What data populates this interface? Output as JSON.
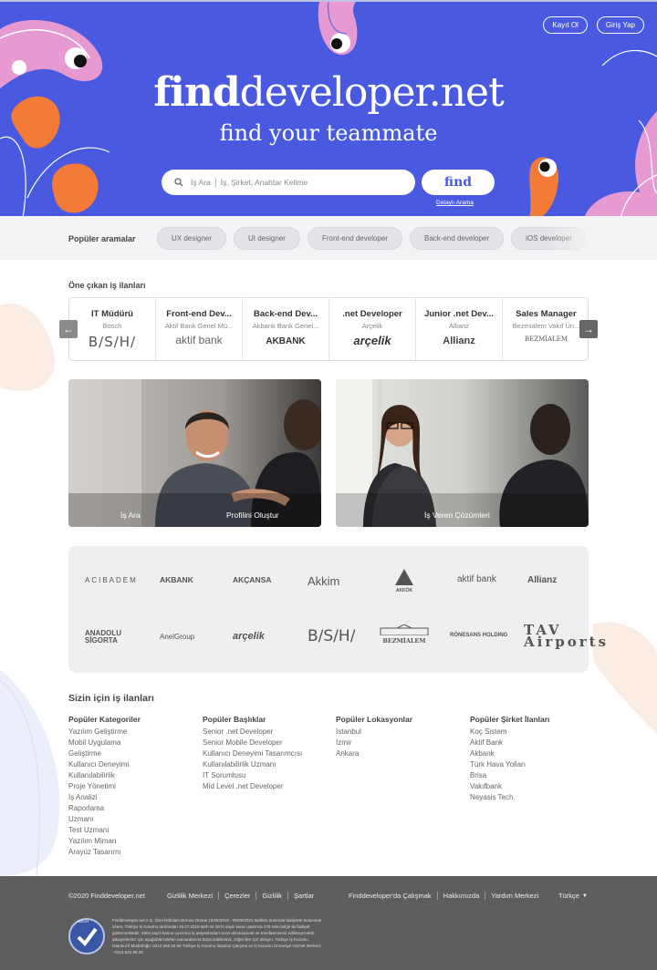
{
  "header": {
    "register": "Kayıt Ol",
    "login": "Giriş Yap",
    "logo_bold": "find",
    "logo_rest": "developer.net",
    "tagline": "find your teammate",
    "search_label": "İş Ara",
    "search_placeholder": "İş, Şirket, Anahtar Kelime",
    "find_button": "find",
    "advanced_search": "Detaylı Arama"
  },
  "popular": {
    "label": "Popüler aramalar",
    "chips": [
      "UX designer",
      "UI designer",
      "Front-end developer",
      "Back-end developer",
      "iOS developer"
    ]
  },
  "featured": {
    "title": "Öne çıkan iş ilanları",
    "jobs": [
      {
        "title": "IT Müdürü",
        "company": "Bosch",
        "logo": "B/S/H/"
      },
      {
        "title": "Front-end Dev...",
        "company": "Aktif Bank Genel Mü...",
        "logo": "aktif bank"
      },
      {
        "title": "Back-end Dev...",
        "company": "Akbank Bank Genel...",
        "logo": "AKBANK"
      },
      {
        "title": ".net Developer",
        "company": "Arçelik",
        "logo": "arçelik"
      },
      {
        "title": "Junior .net Dev...",
        "company": "Allianz",
        "logo": "Allianz"
      },
      {
        "title": "Sales Manager",
        "company": "Bezmialem Vakıf Ün...",
        "logo": "BEZMİALEM"
      }
    ]
  },
  "cards": {
    "job_search": "İş Ara",
    "create_profile": "Profilini Oluştur",
    "employer": "İş Veren Çözümleri"
  },
  "partners": {
    "row1": [
      "ACIBADEM",
      "AKBANK",
      "AKÇANSA",
      "Akkim",
      "AKKÖK",
      "aktif bank",
      "Allianz"
    ],
    "row2": [
      "ANADOLU SİGORTA",
      "AnelGroup",
      "arçelik",
      "B/S/H/",
      "BEZMİALEM",
      "RÖNESANS HOLDING",
      "TAV Airports"
    ]
  },
  "for_you": {
    "title": "Sizin için iş ilanları",
    "columns": [
      {
        "heading": "Popüler Kategoriler",
        "items": [
          "Yazılım Geliştirme",
          "Mobil Uygulama",
          "Geliştirme",
          "Kullanıcı Deneyimi",
          "Kullanılabilirlik",
          "Proje Yönetimi",
          "İş Analizi",
          "Raporlama",
          "Uzmanı",
          "Test Uzmanı",
          "Yazılım Mimarı",
          "Arayüz Tasarımı"
        ]
      },
      {
        "heading": "Popüler Başlıklar",
        "items": [
          "Senior .net Developer",
          "Senior Mobile Developer",
          "Kullanıcı Deneyimi Tasarımcısı",
          "Kullanılabilirlik Uzmanı",
          "IT Sorumlusu",
          "Mid Level .net Developer"
        ]
      },
      {
        "heading": "Popüler Lokasyonlar",
        "items": [
          "İstanbul",
          "İzmir",
          "Ankara"
        ]
      },
      {
        "heading": "Popüler Şirket İlanları",
        "items": [
          "Koç Sistem",
          "Aktif Bank",
          "Akbank",
          "Türk Hava Yolları",
          "Brisa",
          "Vakıfbank",
          "Neyasis Tech."
        ]
      }
    ]
  },
  "footer": {
    "copyright": "©2020 Finddeveloper.net",
    "links": [
      "Gizlilik Merkezi",
      "Çerezler",
      "Gizlilik",
      "Şartlar"
    ],
    "right_links": [
      "Finddeveloper'da Çalışmak",
      "Hakkımızda",
      "Yardım Merkezi"
    ],
    "language": "Türkçe",
    "badge": "İŞKUR",
    "legal": "Finddeveloper.net A.Ş. Özel İstihdam Bürosu Olarak 10/08/2019 - 05/08/2021 tarihleri arasında faaliyette bulunmak üzere, Türkiye İş Kurumu tarafından 16.07.2019 tarih ve 2674 sayılı karar uyarınca 170 nolu belge ile faaliyet göstermektedir. 4904 sayılı kanun uyarınca iş arayanlardan ücret alınmayacak ve menfaat temin edilmeyecektir. Şikayetleriniz için aşağıdaki telefon numaralarına başvurabilirsiniz. Diğer iller için tıklayın. Türkiye İş Kurumu İstanbul İl Müdürlüğü: 0212 555 55 55 Türkiye İş Kurumu İstanbul Çalışma ve İş Kurumu Ümraniye Hizmet Merkezi : 0216 523 90 26"
  }
}
